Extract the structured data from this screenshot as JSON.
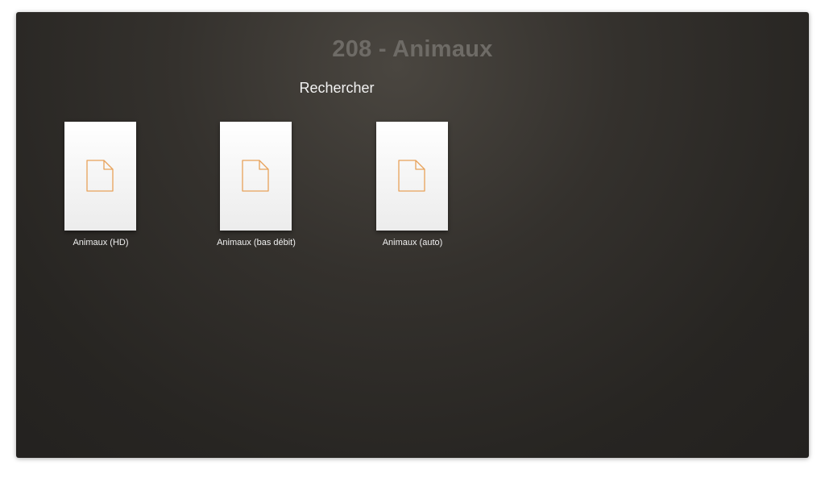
{
  "header": {
    "title": "208 - Animaux"
  },
  "search": {
    "label": "Rechercher"
  },
  "items": [
    {
      "label": "Animaux (HD)",
      "icon": "document-icon"
    },
    {
      "label": "Animaux (bas débit)",
      "icon": "document-icon"
    },
    {
      "label": "Animaux (auto)",
      "icon": "document-icon"
    }
  ],
  "colors": {
    "icon_accent": "#e8a25a",
    "title_text": "#6e6b66",
    "label_text": "#f0f0f0"
  }
}
